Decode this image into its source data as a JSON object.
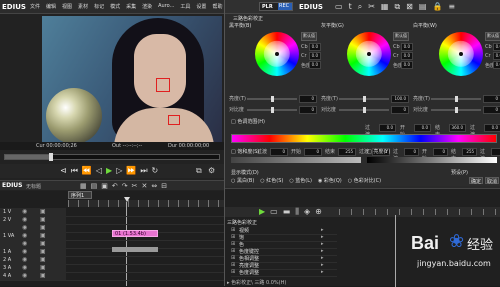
{
  "app": {
    "name": "EDIUS",
    "menus": [
      "文件",
      "编辑",
      "视图",
      "素材",
      "标记",
      "模式",
      "采集",
      "渲染",
      "Auro...",
      "工具",
      "设置",
      "帮助"
    ]
  },
  "player": {
    "cue_in": "Cur 00:00:00;26",
    "out": "Out --:--:--;--",
    "dur": "Dur 00:00:00;00",
    "extra": "-- -- --",
    "timecode": "00:00:00;00"
  },
  "plr_toggle": [
    "PLR",
    "REC"
  ],
  "editor2_title": "EDIUS",
  "bin": {
    "title": "EDIUS",
    "sub": "无标题"
  },
  "timeline": {
    "sequence_tab": "序列1",
    "tracks": [
      "1 V",
      "2 V",
      "",
      "1 VA",
      "",
      "1 A",
      "2 A",
      "3 A",
      "4 A"
    ],
    "clip_label": "01 (1.53.4b)"
  },
  "cc": {
    "title": "三路色彩校正",
    "groups": [
      {
        "label": "黑平衡(B)",
        "reset": "默认值",
        "fields": [
          {
            "k": "Cb",
            "v": "0.0"
          },
          {
            "k": "Cr",
            "v": "0.0"
          },
          {
            "k": "色度",
            "v": "0.0"
          }
        ]
      },
      {
        "label": "灰平衡(G)",
        "reset": "默认值",
        "fields": [
          {
            "k": "Cb",
            "v": "0.0"
          },
          {
            "k": "Cr",
            "v": "0.0"
          },
          {
            "k": "色度",
            "v": "0.0"
          }
        ]
      },
      {
        "label": "白平衡(W)",
        "reset": "默认值",
        "fields": [
          {
            "k": "Cb",
            "v": "0.0"
          },
          {
            "k": "Cr",
            "v": "0.0"
          },
          {
            "k": "色度",
            "v": "0.0"
          }
        ]
      }
    ],
    "slider_rows": [
      {
        "label": "亮度(T)",
        "values": [
          "0",
          "100.0",
          "0"
        ]
      },
      {
        "label": "对比度",
        "values": [
          "0",
          "0",
          "0"
        ]
      }
    ],
    "hue_section": {
      "label": "□ 色调范围(H)",
      "fields": [
        {
          "k": "过渡",
          "v": "0.0"
        },
        {
          "k": "开始",
          "v": "0.0"
        },
        {
          "k": "结束",
          "v": "360.0"
        },
        {
          "k": "过渡",
          "v": "0.0"
        }
      ]
    },
    "sat_row": {
      "label": "□ 饱和度(S)",
      "fields": [
        {
          "k": "过渡",
          "v": "0"
        },
        {
          "k": "开始",
          "v": "0"
        },
        {
          "k": "结束",
          "v": "255"
        },
        {
          "k": "过渡",
          "v": "0"
        }
      ]
    },
    "lum_row": {
      "label": "□ 亮度(Y)",
      "fields": [
        {
          "k": "过渡",
          "v": "0"
        },
        {
          "k": "开始",
          "v": "0"
        },
        {
          "k": "结束",
          "v": "255"
        },
        {
          "k": "过渡",
          "v": "0"
        }
      ]
    },
    "ext": {
      "label": "□ 淡化",
      "fields": [
        {
          "k": "开始",
          "v": "0.0"
        },
        {
          "k": "结束",
          "v": "0.0"
        }
      ]
    },
    "mode_label": "显示模式(D)",
    "modes": [
      "○ 黑白(B)",
      "○ 红色(S)",
      "○ 蓝色(L)",
      "◉ 彩色(Q)",
      "○ 色彩对比(C)"
    ],
    "presets_label": "预设(P)",
    "buttons": [
      "确定",
      "取消"
    ]
  },
  "effect_tree": {
    "root": "三路色彩校正",
    "items": [
      "视频",
      "饱",
      "色",
      "色度键控",
      "色相调整",
      "亮度调整",
      "色度调整"
    ],
    "footer": "▸ 色彩校正\\ 三路 0.0%(H)"
  },
  "watermark": {
    "brand": "Bai",
    "brand2": "经验",
    "url": "jingyan.baidu.com"
  }
}
